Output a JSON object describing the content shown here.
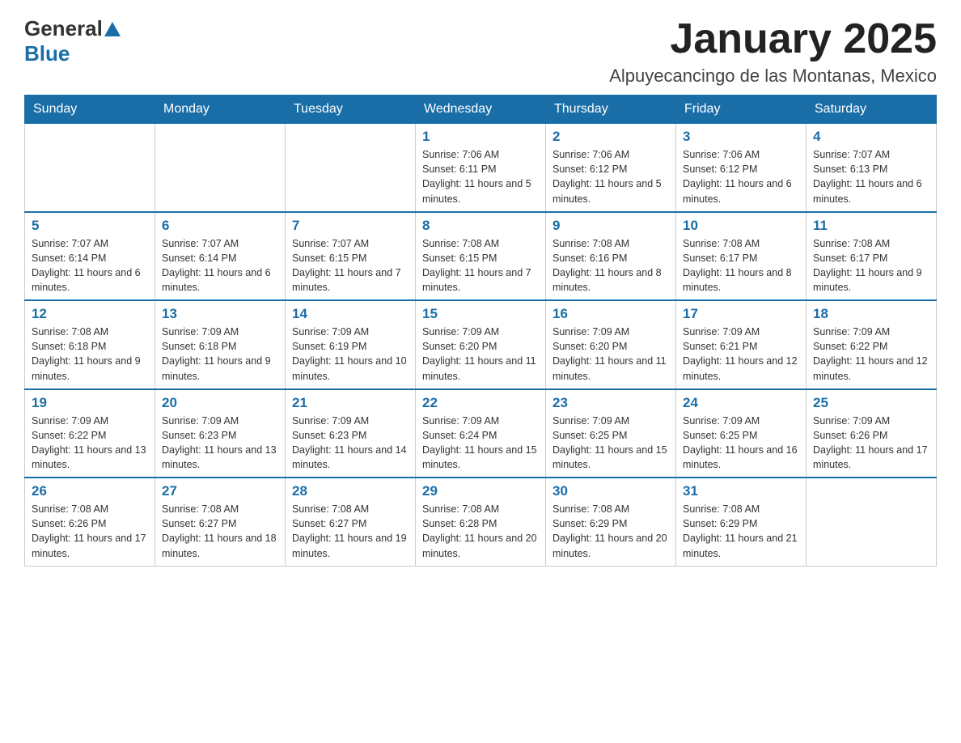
{
  "header": {
    "logo_general": "General",
    "logo_blue": "Blue",
    "month_title": "January 2025",
    "location": "Alpuyecancingo de las Montanas, Mexico"
  },
  "days_of_week": [
    "Sunday",
    "Monday",
    "Tuesday",
    "Wednesday",
    "Thursday",
    "Friday",
    "Saturday"
  ],
  "weeks": [
    [
      {
        "day": "",
        "info": ""
      },
      {
        "day": "",
        "info": ""
      },
      {
        "day": "",
        "info": ""
      },
      {
        "day": "1",
        "info": "Sunrise: 7:06 AM\nSunset: 6:11 PM\nDaylight: 11 hours and 5 minutes."
      },
      {
        "day": "2",
        "info": "Sunrise: 7:06 AM\nSunset: 6:12 PM\nDaylight: 11 hours and 5 minutes."
      },
      {
        "day": "3",
        "info": "Sunrise: 7:06 AM\nSunset: 6:12 PM\nDaylight: 11 hours and 6 minutes."
      },
      {
        "day": "4",
        "info": "Sunrise: 7:07 AM\nSunset: 6:13 PM\nDaylight: 11 hours and 6 minutes."
      }
    ],
    [
      {
        "day": "5",
        "info": "Sunrise: 7:07 AM\nSunset: 6:14 PM\nDaylight: 11 hours and 6 minutes."
      },
      {
        "day": "6",
        "info": "Sunrise: 7:07 AM\nSunset: 6:14 PM\nDaylight: 11 hours and 6 minutes."
      },
      {
        "day": "7",
        "info": "Sunrise: 7:07 AM\nSunset: 6:15 PM\nDaylight: 11 hours and 7 minutes."
      },
      {
        "day": "8",
        "info": "Sunrise: 7:08 AM\nSunset: 6:15 PM\nDaylight: 11 hours and 7 minutes."
      },
      {
        "day": "9",
        "info": "Sunrise: 7:08 AM\nSunset: 6:16 PM\nDaylight: 11 hours and 8 minutes."
      },
      {
        "day": "10",
        "info": "Sunrise: 7:08 AM\nSunset: 6:17 PM\nDaylight: 11 hours and 8 minutes."
      },
      {
        "day": "11",
        "info": "Sunrise: 7:08 AM\nSunset: 6:17 PM\nDaylight: 11 hours and 9 minutes."
      }
    ],
    [
      {
        "day": "12",
        "info": "Sunrise: 7:08 AM\nSunset: 6:18 PM\nDaylight: 11 hours and 9 minutes."
      },
      {
        "day": "13",
        "info": "Sunrise: 7:09 AM\nSunset: 6:18 PM\nDaylight: 11 hours and 9 minutes."
      },
      {
        "day": "14",
        "info": "Sunrise: 7:09 AM\nSunset: 6:19 PM\nDaylight: 11 hours and 10 minutes."
      },
      {
        "day": "15",
        "info": "Sunrise: 7:09 AM\nSunset: 6:20 PM\nDaylight: 11 hours and 11 minutes."
      },
      {
        "day": "16",
        "info": "Sunrise: 7:09 AM\nSunset: 6:20 PM\nDaylight: 11 hours and 11 minutes."
      },
      {
        "day": "17",
        "info": "Sunrise: 7:09 AM\nSunset: 6:21 PM\nDaylight: 11 hours and 12 minutes."
      },
      {
        "day": "18",
        "info": "Sunrise: 7:09 AM\nSunset: 6:22 PM\nDaylight: 11 hours and 12 minutes."
      }
    ],
    [
      {
        "day": "19",
        "info": "Sunrise: 7:09 AM\nSunset: 6:22 PM\nDaylight: 11 hours and 13 minutes."
      },
      {
        "day": "20",
        "info": "Sunrise: 7:09 AM\nSunset: 6:23 PM\nDaylight: 11 hours and 13 minutes."
      },
      {
        "day": "21",
        "info": "Sunrise: 7:09 AM\nSunset: 6:23 PM\nDaylight: 11 hours and 14 minutes."
      },
      {
        "day": "22",
        "info": "Sunrise: 7:09 AM\nSunset: 6:24 PM\nDaylight: 11 hours and 15 minutes."
      },
      {
        "day": "23",
        "info": "Sunrise: 7:09 AM\nSunset: 6:25 PM\nDaylight: 11 hours and 15 minutes."
      },
      {
        "day": "24",
        "info": "Sunrise: 7:09 AM\nSunset: 6:25 PM\nDaylight: 11 hours and 16 minutes."
      },
      {
        "day": "25",
        "info": "Sunrise: 7:09 AM\nSunset: 6:26 PM\nDaylight: 11 hours and 17 minutes."
      }
    ],
    [
      {
        "day": "26",
        "info": "Sunrise: 7:08 AM\nSunset: 6:26 PM\nDaylight: 11 hours and 17 minutes."
      },
      {
        "day": "27",
        "info": "Sunrise: 7:08 AM\nSunset: 6:27 PM\nDaylight: 11 hours and 18 minutes."
      },
      {
        "day": "28",
        "info": "Sunrise: 7:08 AM\nSunset: 6:27 PM\nDaylight: 11 hours and 19 minutes."
      },
      {
        "day": "29",
        "info": "Sunrise: 7:08 AM\nSunset: 6:28 PM\nDaylight: 11 hours and 20 minutes."
      },
      {
        "day": "30",
        "info": "Sunrise: 7:08 AM\nSunset: 6:29 PM\nDaylight: 11 hours and 20 minutes."
      },
      {
        "day": "31",
        "info": "Sunrise: 7:08 AM\nSunset: 6:29 PM\nDaylight: 11 hours and 21 minutes."
      },
      {
        "day": "",
        "info": ""
      }
    ]
  ]
}
